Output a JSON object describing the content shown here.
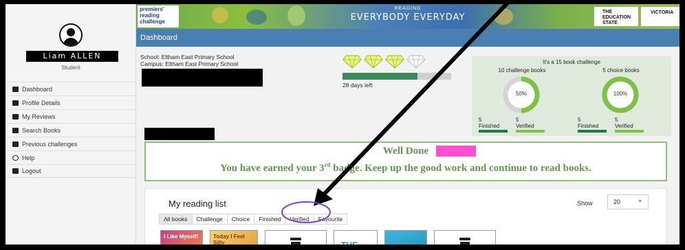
{
  "sidebar": {
    "username": "Liam ALLEN",
    "role": "Student",
    "menu": [
      {
        "label": "Dashboard",
        "icon": "grid-icon"
      },
      {
        "label": "Profile Details",
        "icon": "profile-icon"
      },
      {
        "label": "My Reviews",
        "icon": "reviews-icon"
      },
      {
        "label": "Search Books",
        "icon": "search-books-icon"
      },
      {
        "label": "Previous challenges",
        "icon": "trophy-icon"
      },
      {
        "label": "Help",
        "icon": "help-icon"
      },
      {
        "label": "Logout",
        "icon": "logout-icon"
      }
    ]
  },
  "banner": {
    "brand": [
      "premiers'",
      "reading",
      "challenge"
    ],
    "tag": "READING",
    "slogan": "EVERYBODY EVERYDAY",
    "education": [
      "THE",
      "EDUCATION",
      "STATE"
    ],
    "victoria": "VICTORIA"
  },
  "header": {
    "title": "Dashboard"
  },
  "school": {
    "school": "School: Eltham East Primary School",
    "campus": "Campus: Eltham East Primary School"
  },
  "progress": {
    "fraction": 0.69,
    "days_left": "28 days left"
  },
  "challenge": {
    "title": "It's a 15 book challenge",
    "challenge_books": {
      "label": "10 challenge books",
      "percent": 50,
      "percent_label": "50%",
      "finished": "5",
      "verified": "5",
      "finished_label": "Finished",
      "verified_label": "Verified"
    },
    "choice_books": {
      "label": "5 choice books",
      "percent": 100,
      "percent_label": "100%",
      "finished": "5",
      "verified": "5",
      "finished_label": "Finished",
      "verified_label": "Verified"
    }
  },
  "welldone": {
    "title": "Well Done",
    "line_start": "You have earned your 3",
    "line_sup": "rd",
    "line_end": " badge. Keep up the good work and continue to read books."
  },
  "reading_list": {
    "title": "My reading list",
    "show_label": "Show",
    "show_value": "20",
    "tabs": [
      "All books",
      "Challenge",
      "Choice",
      "Finished",
      "Verified",
      "Favourite"
    ]
  },
  "books": [
    "I Like Myself!",
    "Today I Feel Silly",
    "",
    "THE",
    "",
    ""
  ],
  "colors": {
    "accent": "#4a7fb4",
    "success": "#7cc244",
    "annotation": "#7b3fe4"
  }
}
